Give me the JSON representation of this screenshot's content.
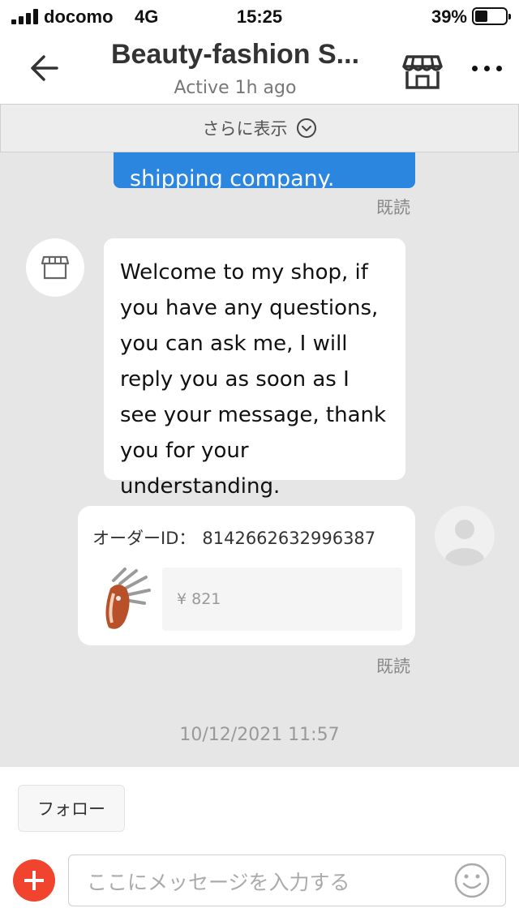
{
  "status_bar": {
    "carrier": "docomo",
    "network": "4G",
    "time": "15:25",
    "battery": "39%",
    "battery_level": 0.39
  },
  "header": {
    "title": "Beauty-fashion S...",
    "subtitle": "Active 1h ago",
    "icons": [
      "back-arrow-icon",
      "store-icon",
      "more-icon"
    ]
  },
  "show_more": {
    "label": "さらに表示"
  },
  "messages": {
    "sent_partial": "shipping company.",
    "read_label_1": "既読",
    "received": "Welcome to my shop, if you have any questions, you can ask me, I will reply you as soon as I see your message, thank you for your understanding.",
    "order": {
      "id_label": "オーダーID：",
      "id_value": "8142662632996387",
      "price": "¥ 821"
    },
    "read_label_2": "既読",
    "timestamp": "10/12/2021 11:57"
  },
  "bottom": {
    "follow_label": "フォロー",
    "input_placeholder": "ここにメッセージを入力する"
  },
  "colors": {
    "accent_blue": "#2b86e0",
    "plus_red": "#f0442e",
    "chat_bg": "#e6e6e6"
  }
}
